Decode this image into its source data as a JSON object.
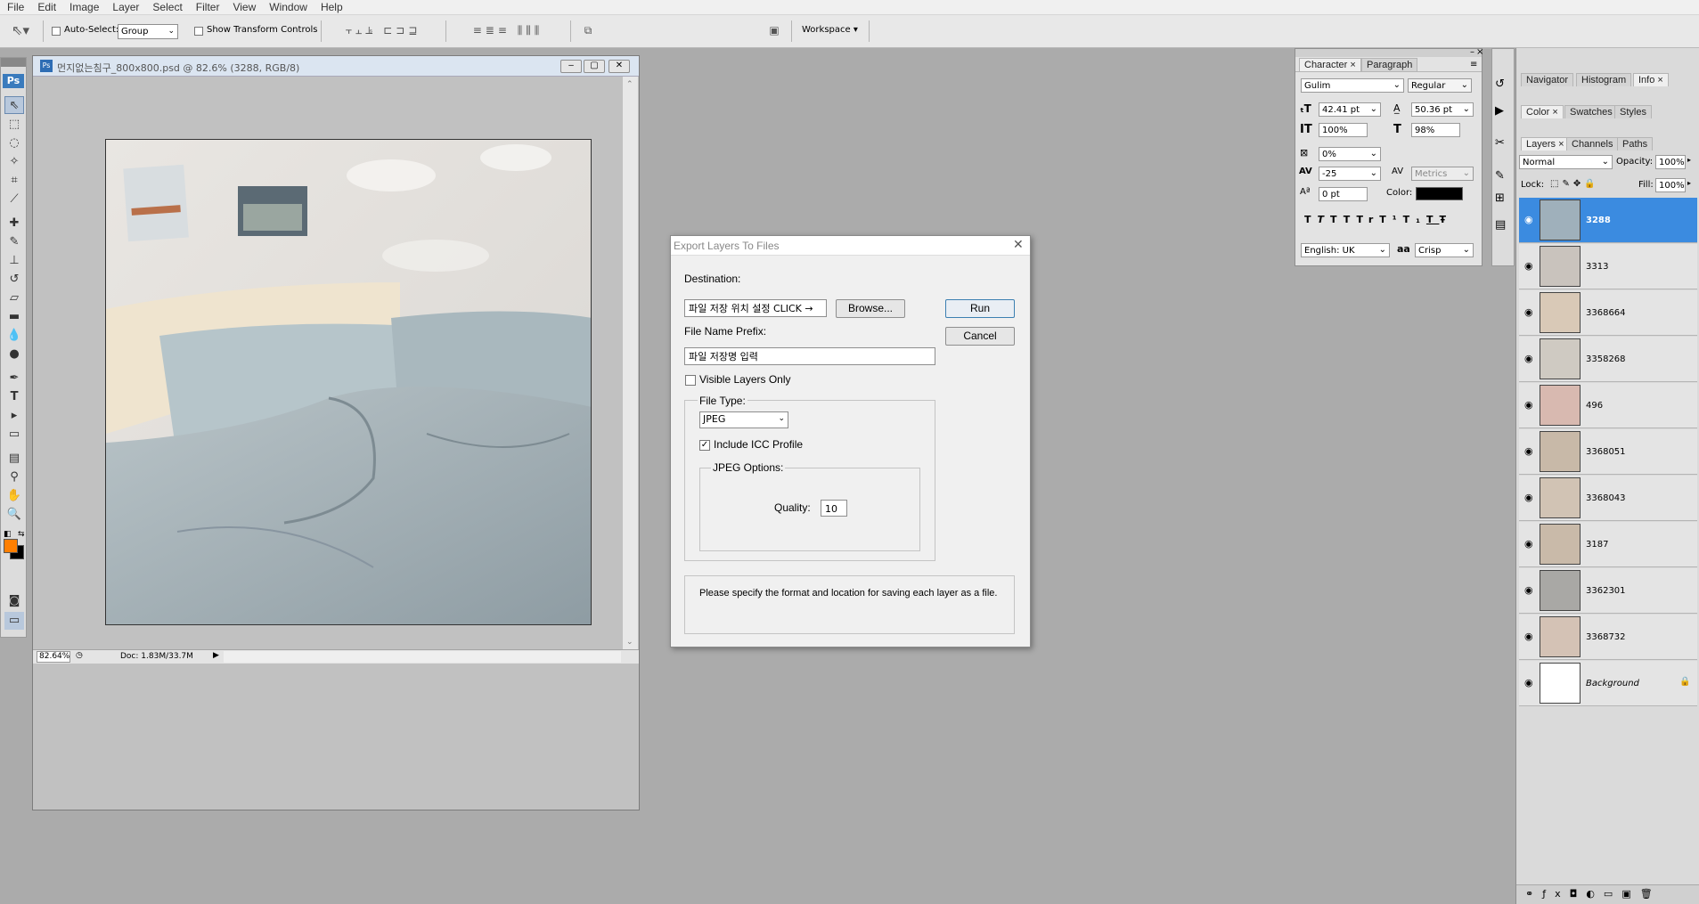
{
  "menu": [
    "File",
    "Edit",
    "Image",
    "Layer",
    "Select",
    "Filter",
    "View",
    "Window",
    "Help"
  ],
  "options": {
    "auto_select_label": "Auto-Select:",
    "auto_select_value": "Group",
    "show_transform_label": "Show Transform Controls",
    "workspace_label": "Workspace"
  },
  "toolbox": {
    "logo": "Ps",
    "foreground_color": "#ff7f00",
    "background_color": "#000000"
  },
  "document": {
    "title": "먼지없는침구_800x800.psd @ 82.6% (3288, RGB/8)",
    "zoom": "82.64%",
    "doc_info": "Doc: 1.83M/33.7M"
  },
  "dialog": {
    "title": "Export Layers To Files",
    "destination_label": "Destination:",
    "destination_value": "파일 저장 위치 설정 CLICK →",
    "browse_label": "Browse...",
    "run_label": "Run",
    "cancel_label": "Cancel",
    "prefix_label": "File Name Prefix:",
    "prefix_value": "파일 저장명 입력",
    "visible_only_label": "Visible Layers Only",
    "file_type_label": "File Type:",
    "file_type_value": "JPEG",
    "icc_label": "Include ICC Profile",
    "jpeg_options_label": "JPEG Options:",
    "quality_label": "Quality:",
    "quality_value": "10",
    "description": "Please specify the format and location for saving each layer as a file."
  },
  "character": {
    "tabs": [
      "Character",
      "Paragraph"
    ],
    "font_family": "Gulim",
    "font_style": "Regular",
    "size": "42.41 pt",
    "leading": "50.36 pt",
    "vert_scale": "100%",
    "horiz_scale": "98%",
    "tsume": "0%",
    "kerning": "-25",
    "tracking": "Metrics",
    "baseline": "0 pt",
    "color_label": "Color:",
    "language": "English: UK",
    "aa_icon": "aa",
    "antialias": "Crisp",
    "style_buttons": [
      "T",
      "T",
      "TT",
      "Tr",
      "T¹",
      "T₁",
      "T",
      "Ŧ"
    ]
  },
  "right_panel": {
    "tabs_top": [
      "Navigator",
      "Histogram",
      "Info"
    ],
    "tabs_mid": [
      "Color",
      "Swatches",
      "Styles"
    ],
    "tabs_layers": [
      "Layers",
      "Channels",
      "Paths"
    ],
    "blend_mode": "Normal",
    "opacity_label": "Opacity:",
    "opacity": "100%",
    "lock_label": "Lock:",
    "fill_label": "Fill:",
    "fill": "100%",
    "layers": [
      {
        "name": "3288",
        "active": true
      },
      {
        "name": "3313",
        "active": false
      },
      {
        "name": "3368664",
        "active": false
      },
      {
        "name": "3358268",
        "active": false
      },
      {
        "name": "496",
        "active": false
      },
      {
        "name": "3368051",
        "active": false
      },
      {
        "name": "3368043",
        "active": false
      },
      {
        "name": "3187",
        "active": false
      },
      {
        "name": "3362301",
        "active": false
      },
      {
        "name": "3368732",
        "active": false
      },
      {
        "name": "Background",
        "active": false
      }
    ]
  }
}
